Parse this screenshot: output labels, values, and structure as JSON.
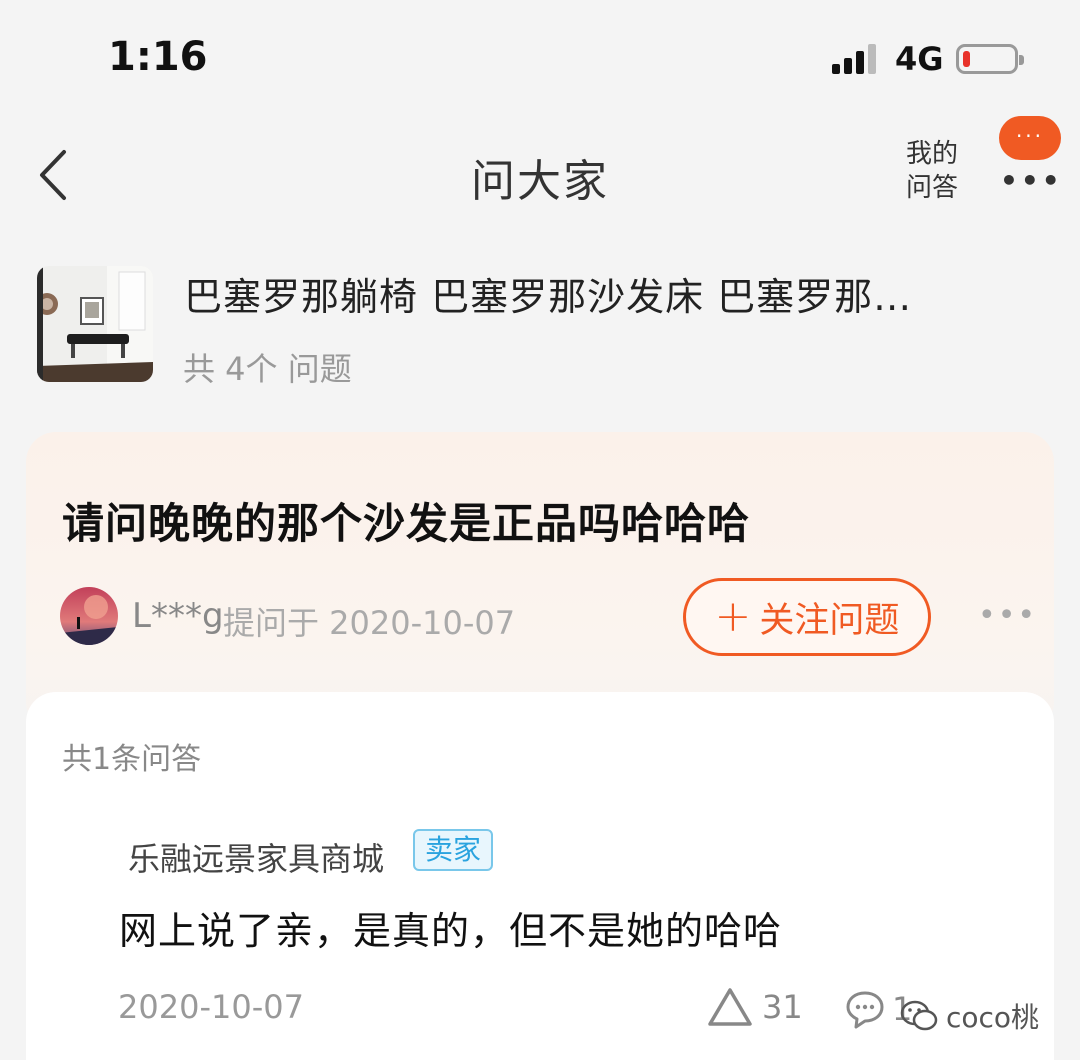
{
  "status_bar": {
    "time": "1:16",
    "network": "4G"
  },
  "nav": {
    "title": "问大家",
    "my_qa_line1": "我的",
    "my_qa_line2": "问答",
    "more_dots": "•••",
    "bubble_dots": "···"
  },
  "product": {
    "title": "巴塞罗那躺椅 巴塞罗那沙发床 巴塞罗那…",
    "question_count": "共 4个 问题"
  },
  "question": {
    "text": "请问晚晚的那个沙发是正品吗哈哈哈",
    "asker": "L***g",
    "asked_at": "提问于 2020-10-07",
    "follow_label": "关注问题",
    "more": "•••"
  },
  "answers": {
    "count_label": "共1条问答",
    "items": [
      {
        "name": "乐融远景家具商城",
        "badge": "卖家",
        "text": "网上说了亲，是真的，但不是她的哈哈",
        "date": "2020-10-07",
        "likes": "31",
        "comments": "1"
      }
    ]
  },
  "watermark": "coco桃",
  "colors": {
    "accent": "#f05a23",
    "badge": "#2aa3df",
    "battery_low": "#e8322a"
  }
}
